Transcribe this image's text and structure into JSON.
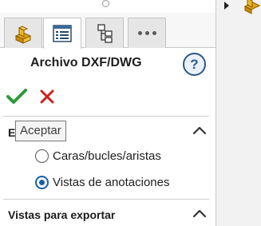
{
  "panel": {
    "tabs": [
      {
        "icon": "feature-manager-icon"
      },
      {
        "icon": "property-manager-icon",
        "selected": true
      },
      {
        "icon": "configuration-manager-icon"
      },
      {
        "icon": "more-icon"
      }
    ],
    "title": "Archivo DXF/DWG",
    "help_label": "?",
    "tooltip": "Aceptar",
    "section_one_letter": "E",
    "options": [
      {
        "label": "Caras/bucles/aristas",
        "selected": false
      },
      {
        "label": "Vistas de anotaciones",
        "selected": true
      }
    ],
    "section_two_title": "Vistas para exportar"
  },
  "colors": {
    "ok_green": "#2e9a3a",
    "cancel_red": "#c8231e",
    "radio_blue": "#1a5fa8",
    "help_blue": "#2d5a86"
  }
}
